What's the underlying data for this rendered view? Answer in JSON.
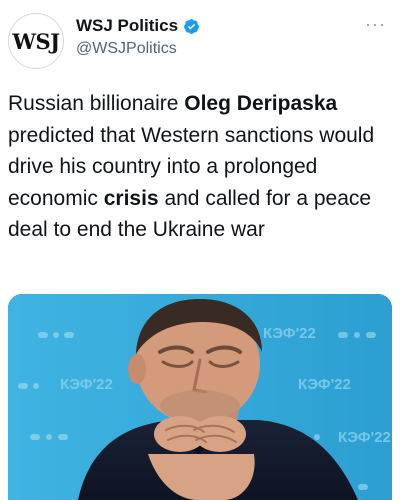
{
  "account": {
    "display_name": "WSJ Politics",
    "handle": "@WSJPolitics",
    "avatar_text": "WSJ",
    "more_label": "···"
  },
  "tweet": {
    "t1": "Russian billionaire ",
    "b1": "Oleg Deripaska",
    "t2": " predicted that Western sanctions would drive his country into a prolonged economic ",
    "b2": "crisis",
    "t3": " and called for a peace deal to end the Ukraine war"
  },
  "media": {
    "backdrop_label": "КЭФ'22"
  },
  "colors": {
    "verified_blue": "#1d9bf0",
    "backdrop_blue": "#33a8d8"
  },
  "icons": [
    "verified-badge-icon",
    "more-options-icon"
  ]
}
